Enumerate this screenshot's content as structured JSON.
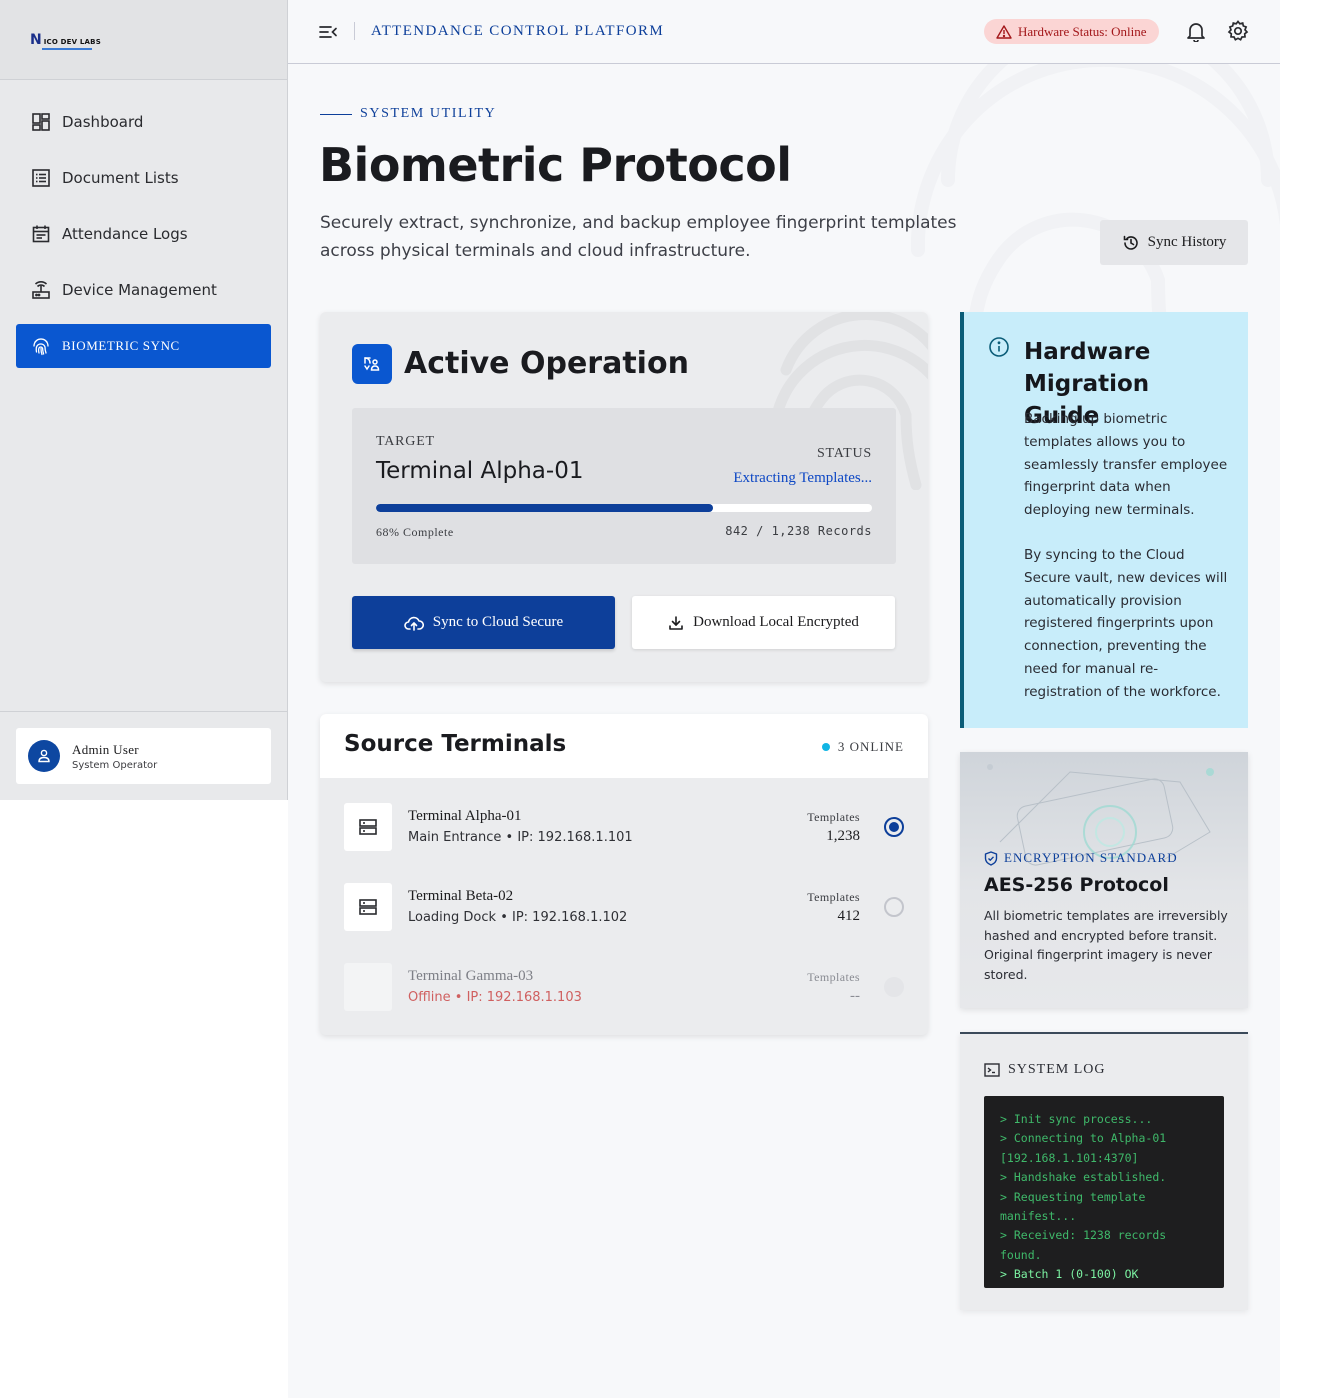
{
  "brand": {
    "logo_initial": "N",
    "logo_text": "ICO DEV LABS"
  },
  "sidebar": {
    "items": [
      {
        "label": "Dashboard",
        "icon": "dashboard-icon"
      },
      {
        "label": "Document Lists",
        "icon": "list-icon"
      },
      {
        "label": "Attendance Logs",
        "icon": "calendar-icon"
      },
      {
        "label": "Device Management",
        "icon": "router-icon"
      },
      {
        "label": "Biometric Sync",
        "icon": "fingerprint-icon",
        "active": true
      }
    ],
    "user": {
      "name": "Admin User",
      "role": "System Operator"
    }
  },
  "header": {
    "platform_title": "ATTENDANCE CONTROL PLATFORM",
    "hardware_status": "Hardware Status: Online"
  },
  "page": {
    "eyebrow": "SYSTEM UTILITY",
    "title": "Biometric Protocol",
    "description": "Securely extract, synchronize, and backup employee fingerprint templates across physical terminals and cloud infrastructure.",
    "sync_history_label": "Sync History"
  },
  "operation": {
    "title": "Active Operation",
    "target_label": "TARGET",
    "target_value": "Terminal Alpha-01",
    "status_label": "STATUS",
    "status_value": "Extracting Templates...",
    "progress_percent": 68,
    "progress_text": "68% Complete",
    "records_text": "842 / 1,238 Records",
    "sync_button": "Sync to Cloud Secure",
    "download_button": "Download Local Encrypted"
  },
  "terminals": {
    "title": "Source Terminals",
    "online_badge": "3 ONLINE",
    "templates_label": "Templates",
    "rows": [
      {
        "name": "Terminal Alpha-01",
        "meta": "Main Entrance • IP: 192.168.1.101",
        "templates": "1,238",
        "selected": true,
        "offline": false
      },
      {
        "name": "Terminal Beta-02",
        "meta": "Loading Dock • IP: 192.168.1.102",
        "templates": "412",
        "selected": false,
        "offline": false
      },
      {
        "name": "Terminal Gamma-03",
        "meta": "Offline • IP: 192.168.1.103",
        "templates": "--",
        "selected": false,
        "offline": true
      }
    ]
  },
  "guide": {
    "title": "Hardware Migration Guide",
    "paragraph1": "Backing up biometric templates allows you to seamlessly transfer employee fingerprint data when deploying new terminals.",
    "paragraph2": "By syncing to the Cloud Secure vault, new devices will automatically provision registered fingerprints upon connection, preventing the need for manual re-registration of the workforce."
  },
  "encryption": {
    "eyebrow": "ENCRYPTION STANDARD",
    "title": "AES-256 Protocol",
    "description": "All biometric templates are irreversibly hashed and encrypted before transit. Original fingerprint imagery is never stored."
  },
  "system_log": {
    "title": "SYSTEM LOG",
    "lines": [
      "> Init sync process...",
      "> Connecting to Alpha-01 [192.168.1.101:4370]",
      "> Handshake established.",
      "> Requesting template manifest...",
      "> Received: 1238 records found.",
      "> Batch 1 (0-100) OK"
    ]
  },
  "colors": {
    "accent": "#0a57d0",
    "primary_dark": "#0d3f9a",
    "alert": "#a3171a",
    "online_dot": "#11b5e4",
    "guide_bg": "#c8edfa",
    "log_text": "#3fb96a"
  }
}
